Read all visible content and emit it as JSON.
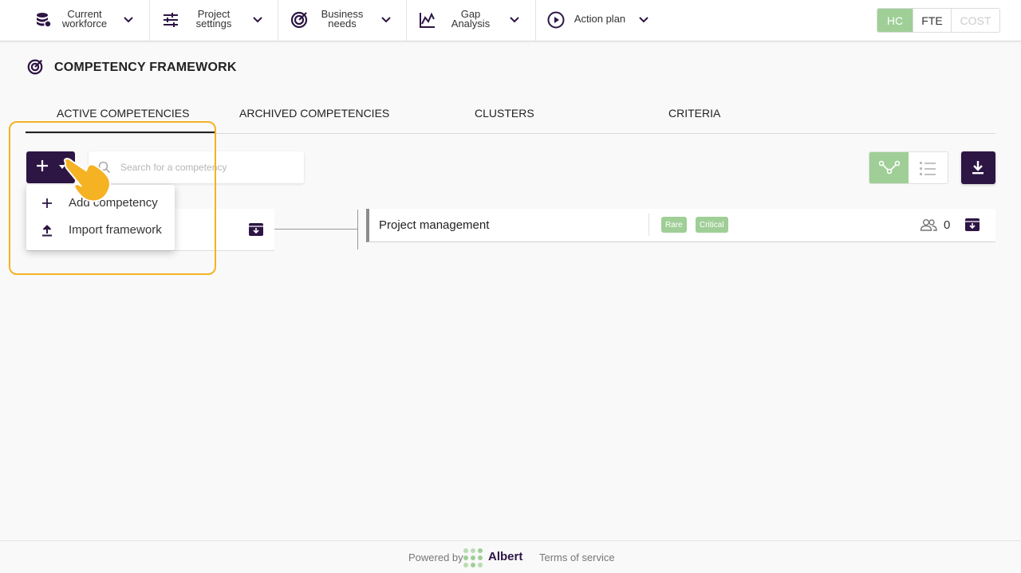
{
  "nav": {
    "items": [
      {
        "label": "Current\nworkforce",
        "icon": "database-icon"
      },
      {
        "label": "Project\nsettings",
        "icon": "sliders-icon"
      },
      {
        "label": "Business\nneeds",
        "icon": "target-icon"
      },
      {
        "label": "Gap\nAnalysis",
        "icon": "chart-icon"
      },
      {
        "label": "Action plan",
        "icon": "play-circle-icon"
      }
    ],
    "units": {
      "hc": "HC",
      "fte": "FTE",
      "cost": "COST",
      "selected": "HC"
    }
  },
  "page": {
    "title": "COMPETENCY FRAMEWORK"
  },
  "tabs": [
    {
      "label": "ACTIVE COMPETENCIES",
      "active": true
    },
    {
      "label": "ARCHIVED COMPETENCIES",
      "active": false
    },
    {
      "label": "CLUSTERS",
      "active": false
    },
    {
      "label": "CRITERIA",
      "active": false
    }
  ],
  "toolbar": {
    "search_placeholder": "Search for a competency",
    "search_value": ""
  },
  "dropdown": {
    "items": [
      {
        "label": "Add competency",
        "icon": "plus-icon"
      },
      {
        "label": "Import framework",
        "icon": "upload-icon"
      }
    ]
  },
  "competency": {
    "name": "Project management",
    "badges": [
      "Rare",
      "Critical"
    ],
    "people_count": "0"
  },
  "footer": {
    "powered_by": "Powered by",
    "brand": "Albert",
    "terms": "Terms of service"
  },
  "colors": {
    "brand_dark": "#2d1544",
    "accent_green": "#9fcf97",
    "highlight": "#f5b223"
  }
}
